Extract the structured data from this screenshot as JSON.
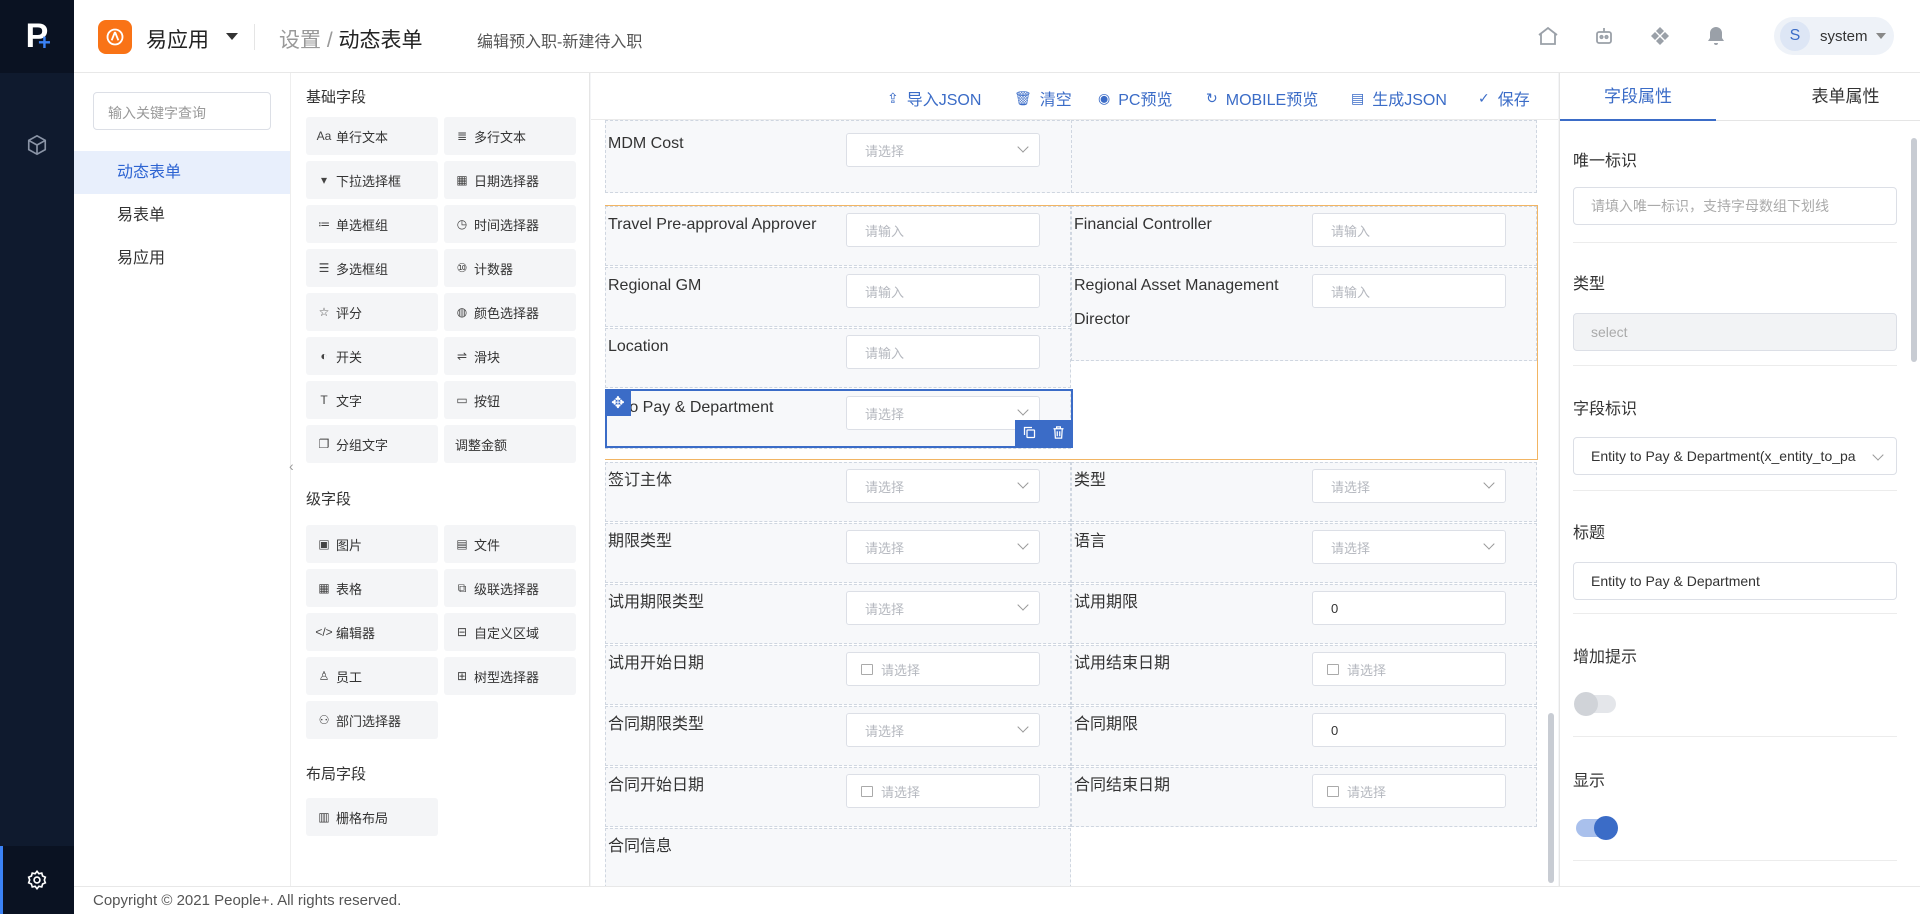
{
  "brand": {
    "logo_letter": "P",
    "logo_plus": "+"
  },
  "header": {
    "app_name": "易应用",
    "breadcrumb_root": "设置",
    "breadcrumb_sep": " / ",
    "breadcrumb_current": "动态表单",
    "subtitle": "编辑预入职-新建待入职",
    "user_initial": "S",
    "user_name": "system"
  },
  "sidebar": {
    "search_placeholder": "输入关键字查询",
    "items": [
      {
        "label": "动态表单"
      },
      {
        "label": "易表单"
      },
      {
        "label": "易应用"
      }
    ]
  },
  "palette": {
    "basic_title": "基础字段",
    "advanced_title": "级字段",
    "layout_title": "布局字段",
    "basic": [
      {
        "label": "单行文本",
        "icon": "Aa"
      },
      {
        "label": "多行文本",
        "icon": "≣"
      },
      {
        "label": "下拉选择框",
        "icon": "▾"
      },
      {
        "label": "日期选择器",
        "icon": "▦"
      },
      {
        "label": "单选框组",
        "icon": "≔"
      },
      {
        "label": "时间选择器",
        "icon": "◷"
      },
      {
        "label": "多选框组",
        "icon": "☰"
      },
      {
        "label": "计数器",
        "icon": "⑩"
      },
      {
        "label": "评分",
        "icon": "☆"
      },
      {
        "label": "颜色选择器",
        "icon": "◍"
      },
      {
        "label": "开关",
        "icon": "◐"
      },
      {
        "label": "滑块",
        "icon": "⇌"
      },
      {
        "label": "文字",
        "icon": "T"
      },
      {
        "label": "按钮",
        "icon": "▭"
      },
      {
        "label": "分组文字",
        "icon": "❐"
      },
      {
        "label": "调整金额",
        "icon": ""
      }
    ],
    "advanced": [
      {
        "label": "图片",
        "icon": "▣"
      },
      {
        "label": "文件",
        "icon": "▤"
      },
      {
        "label": "表格",
        "icon": "▦"
      },
      {
        "label": "级联选择器",
        "icon": "⧉"
      },
      {
        "label": "编辑器",
        "icon": "</>"
      },
      {
        "label": "自定义区域",
        "icon": "⊟"
      },
      {
        "label": "员工",
        "icon": "♙"
      },
      {
        "label": "树型选择器",
        "icon": "⊞"
      },
      {
        "label": "部门选择器",
        "icon": "⚇"
      }
    ],
    "layout": [
      {
        "label": "栅格布局",
        "icon": "▥"
      }
    ]
  },
  "toolbar": {
    "import_json": "导入JSON",
    "clear": "清空",
    "pc_preview": "PC预览",
    "mobile_preview": "MOBILE预览",
    "generate_json": "生成JSON",
    "save": "保存"
  },
  "form": {
    "placeholder_select": "请选择",
    "placeholder_input": "请输入",
    "fields": {
      "mdm_cost": "MDM Cost",
      "travel_approver": "Travel Pre-approval Approver",
      "financial_controller": "Financial Controller",
      "regional_gm": "Regional GM",
      "regional_asset_line1": "Regional Asset Management",
      "regional_asset_line2": "Director",
      "location": "Location",
      "entity_to_pay": "ty to Pay & Department",
      "sign_entity": "签订主体",
      "type": "类型",
      "term_type": "期限类型",
      "language": "语言",
      "probation_type": "试用期限类型",
      "probation_term": "试用期限",
      "probation_term_value": "0",
      "probation_start": "试用开始日期",
      "probation_end": "试用结束日期",
      "contract_term_type": "合同期限类型",
      "contract_term": "合同期限",
      "contract_term_value": "0",
      "contract_start": "合同开始日期",
      "contract_end": "合同结束日期",
      "contract_info": "合同信息"
    }
  },
  "props": {
    "tab_field": "字段属性",
    "tab_form": "表单属性",
    "unique_id_label": "唯一标识",
    "unique_id_placeholder": "请填入唯一标识，支持字母数组下划线",
    "type_label": "类型",
    "type_value": "select",
    "field_id_label": "字段标识",
    "field_id_value": "Entity to Pay & Department(x_entity_to_pa",
    "title_label": "标题",
    "title_value": "Entity to Pay & Department",
    "hint_label": "增加提示",
    "hint_on": false,
    "show_label": "显示",
    "show_on": true
  },
  "footer": {
    "copyright": "Copyright © 2021 People+. All rights reserved."
  },
  "colors": {
    "accent": "#3b6cc7",
    "rail": "#0f1a2e",
    "app_badge": "#f97316",
    "group_border": "#f2b563"
  }
}
